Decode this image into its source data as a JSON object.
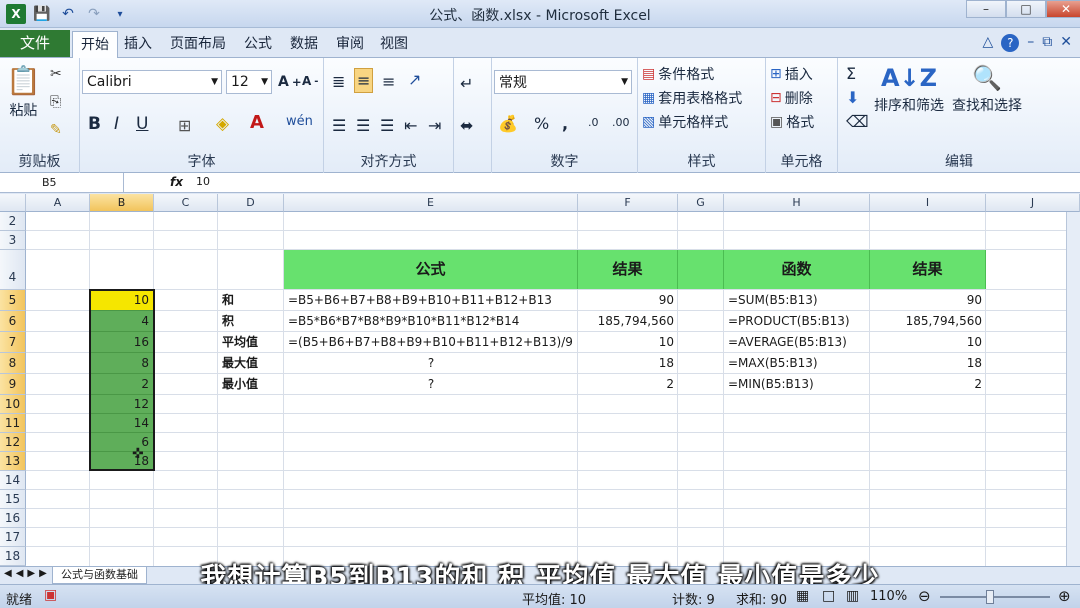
{
  "window": {
    "title": "公式、函数.xlsx - Microsoft Excel"
  },
  "tabs": [
    "文件",
    "开始",
    "插入",
    "页面布局",
    "公式",
    "数据",
    "审阅",
    "视图"
  ],
  "active_tab": "开始",
  "ribbon": {
    "clipboard": {
      "label": "剪贴板",
      "paste": "粘贴"
    },
    "font": {
      "label": "字体",
      "name": "Calibri",
      "size": "12"
    },
    "alignment": {
      "label": "对齐方式"
    },
    "number": {
      "label": "数字",
      "format": "常规"
    },
    "styles": {
      "label": "样式",
      "conditional": "条件格式",
      "table": "套用表格格式",
      "cell": "单元格样式"
    },
    "cells": {
      "label": "单元格",
      "insert": "插入",
      "delete": "删除",
      "format": "格式"
    },
    "editing": {
      "label": "编辑",
      "sort": "排序和筛选",
      "find": "查找和选择"
    }
  },
  "formula_bar": {
    "name_box": "B5",
    "fx": "fx",
    "value": "10"
  },
  "columns": [
    "A",
    "B",
    "C",
    "D",
    "E",
    "F",
    "G",
    "H",
    "I",
    "J"
  ],
  "rows": [
    "2",
    "3",
    "4",
    "5",
    "6",
    "7",
    "8",
    "9",
    "10",
    "11",
    "12",
    "13",
    "14",
    "15",
    "16",
    "17",
    "18"
  ],
  "sheet": {
    "B": [
      "10",
      "4",
      "16",
      "8",
      "2",
      "12",
      "14",
      "6",
      "18"
    ],
    "headers": {
      "formula": "公式",
      "result1": "结果",
      "function": "函数",
      "result2": "结果"
    },
    "table": [
      {
        "label": "和",
        "formula": "=B5+B6+B7+B8+B9+B10+B11+B12+B13",
        "result1": "90",
        "function": "=SUM(B5:B13)",
        "result2": "90"
      },
      {
        "label": "积",
        "formula": "=B5*B6*B7*B8*B9*B10*B11*B12*B14",
        "result1": "185,794,560",
        "function": "=PRODUCT(B5:B13)",
        "result2": "185,794,560"
      },
      {
        "label": "平均值",
        "formula": "=(B5+B6+B7+B8+B9+B10+B11+B12+B13)/9",
        "result1": "10",
        "function": "=AVERAGE(B5:B13)",
        "result2": "10"
      },
      {
        "label": "最大值",
        "formula": "?",
        "result1": "18",
        "function": "=MAX(B5:B13)",
        "result2": "18"
      },
      {
        "label": "最小值",
        "formula": "?",
        "result1": "2",
        "function": "=MIN(B5:B13)",
        "result2": "2"
      }
    ]
  },
  "sheet_tab": "公式与函数基础",
  "status": {
    "ready": "就绪",
    "average": "平均值: 10",
    "count": "计数: 9",
    "sum": "求和: 90",
    "zoom": "110%"
  },
  "caption": "我想计算B5到B13的和 积 平均值 最大值 最小值是多少"
}
